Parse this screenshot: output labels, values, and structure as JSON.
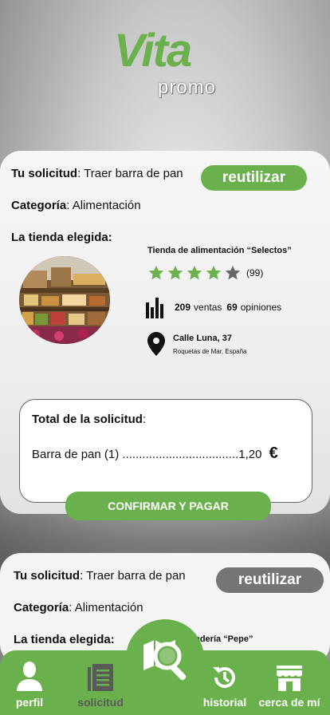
{
  "logo": {
    "vita": "Vita",
    "promo": "promo"
  },
  "request1": {
    "solicitud_label": "Tu solicitud",
    "solicitud_value": ": Traer barra de pan",
    "reuse_label": "reutilizar",
    "categoria_label": "Categoría",
    "categoria_value": ": Alimentación",
    "tienda_label": "La tienda elegida:",
    "store_name": "Tienda de alimentación “Selectos”",
    "rating_filled": 4,
    "rating_max": 5,
    "rating_count": "(99)",
    "sales_count": "209",
    "sales_label": "ventas",
    "reviews_count": "69",
    "reviews_label": "opiniones",
    "address_line": "Calle Luna, 37",
    "address_city": "Roquetas de Mar, España",
    "total_label": "Total de la solicitud",
    "total_colon": ":",
    "item_line": "Barra de pan (1) ...................................1,20",
    "currency": "€",
    "confirm_label": "CONFIRMAR Y PAGAR"
  },
  "request2": {
    "solicitud_label": "Tu solicitud",
    "solicitud_value": ": Traer barra de pan",
    "reuse_label": "reutilizar",
    "categoria_label": "Categoría",
    "categoria_value": ": Alimentación",
    "tienda_label": "La tienda elegida:",
    "store_name_partial": "nadería “Pepe”"
  },
  "nav": {
    "perfil": "perfil",
    "solicitud": "solicitud",
    "historial": "historial",
    "cerca": "cerca de mí"
  },
  "colors": {
    "brand_green": "#6ab04c",
    "grey_button": "#757575",
    "inactive_icon": "#5a5a5a"
  },
  "icons": [
    "user-icon",
    "document-list-icon",
    "search-map-icon",
    "history-icon",
    "store-icon",
    "star-icon",
    "bar-chart-icon",
    "location-pin-icon"
  ]
}
